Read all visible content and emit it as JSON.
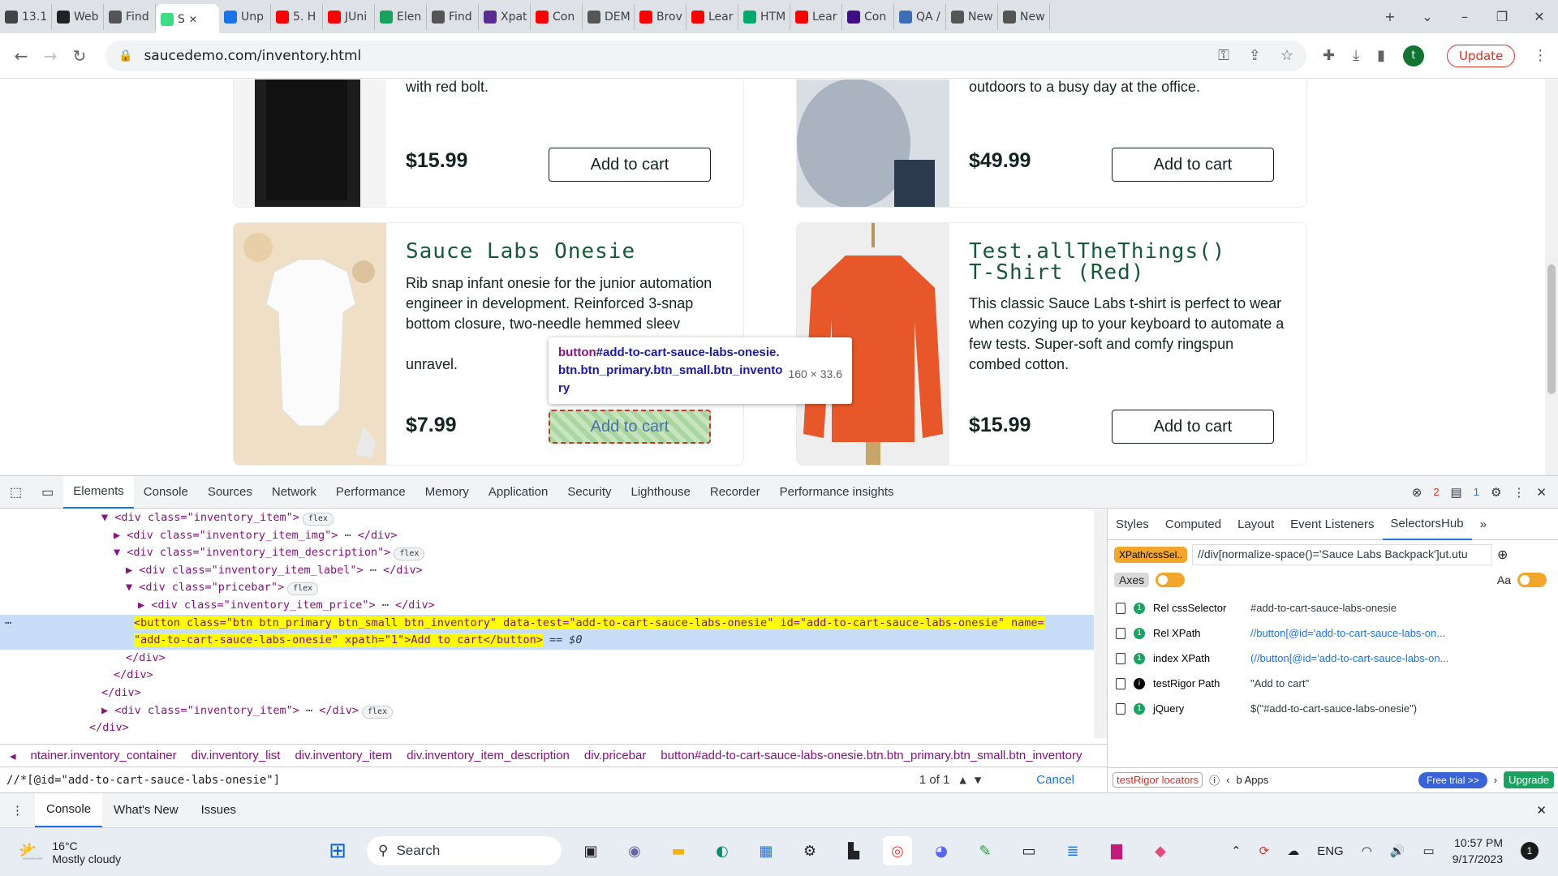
{
  "browser": {
    "tabs": [
      {
        "label": "13.1",
        "color": "#444"
      },
      {
        "label": "Web",
        "color": "#222"
      },
      {
        "label": "Find",
        "color": "#555"
      },
      {
        "label": "S",
        "color": "#3ddc84",
        "active": true
      },
      {
        "label": "Unp",
        "color": "#1a73e8"
      },
      {
        "label": "5. H",
        "color": "#ff0000"
      },
      {
        "label": "JUni",
        "color": "#ff0000"
      },
      {
        "label": "Elen",
        "color": "#1aa260"
      },
      {
        "label": "Find",
        "color": "#555"
      },
      {
        "label": "Xpat",
        "color": "#5c2d91"
      },
      {
        "label": "Con",
        "color": "#ff0000"
      },
      {
        "label": "DEM",
        "color": "#555"
      },
      {
        "label": "Brov",
        "color": "#ff0000"
      },
      {
        "label": "Lear",
        "color": "#ff0000"
      },
      {
        "label": "HTM",
        "color": "#04aa6d"
      },
      {
        "label": "Lear",
        "color": "#ff0000"
      },
      {
        "label": "Con",
        "color": "#3f0e84"
      },
      {
        "label": "QA /",
        "color": "#3b6fb6"
      },
      {
        "label": "New",
        "color": "#555"
      },
      {
        "label": "New",
        "color": "#555"
      }
    ],
    "url": "saucedemo.com/inventory.html",
    "update_label": "Update",
    "profile_initial": "t"
  },
  "products": [
    {
      "name": "",
      "desc": "with red bolt.",
      "price": "$15.99",
      "button": "Add to cart"
    },
    {
      "name": "",
      "desc": "outdoors to a busy day at the office.",
      "price": "$49.99",
      "button": "Add to cart"
    },
    {
      "name": "Sauce Labs Onesie",
      "desc": "Rib snap infant onesie for the junior automation engineer in development. Reinforced 3-snap bottom closure, two-needle hemmed sleev",
      "desc2": "unravel.",
      "price": "$7.99",
      "button": "Add to cart"
    },
    {
      "name": "Test.allTheThings() T-Shirt (Red)",
      "desc": "This classic Sauce Labs t-shirt is perfect to wear when cozying up to your keyboard to automate a few tests. Super-soft and comfy ringspun combed cotton.",
      "price": "$15.99",
      "button": "Add to cart"
    }
  ],
  "tooltip": {
    "selector_tag": "button",
    "selector_rest": "#add-to-cart-sauce-labs-onesie.btn.btn_primary.btn_small.btn_inventory",
    "size": "160 × 33.6"
  },
  "devtools": {
    "tabs": [
      "Elements",
      "Console",
      "Sources",
      "Network",
      "Performance",
      "Memory",
      "Application",
      "Security",
      "Lighthouse",
      "Recorder",
      "Performance insights"
    ],
    "error_count": "2",
    "message_count": "1",
    "dom_lines": [
      {
        "indent": 9,
        "arrow": "▼",
        "html": "<div class=\"inventory_item\">",
        "pill": "flex"
      },
      {
        "indent": 10,
        "arrow": "▶",
        "html": "<div class=\"inventory_item_img\">",
        "tail": "</div>"
      },
      {
        "indent": 10,
        "arrow": "▼",
        "html": "<div class=\"inventory_item_description\">",
        "pill": "flex"
      },
      {
        "indent": 11,
        "arrow": "▶",
        "html": "<div class=\"inventory_item_label\">",
        "tail": "</div>"
      },
      {
        "indent": 11,
        "arrow": "▼",
        "html": "<div class=\"pricebar\">",
        "pill": "flex"
      },
      {
        "indent": 12,
        "arrow": "▶",
        "html": "<div class=\"inventory_item_price\">",
        "tail": "</div>"
      }
    ],
    "selected_line_1": "<button class=\"btn btn_primary btn_small btn_inventory\" data-test=\"add-to-cart-sauce-labs-onesie\" id=\"add-to-cart-sauce-labs-onesie\" name=",
    "selected_line_2": "\"add-to-cart-sauce-labs-onesie\" xpath=\"1\">Add to cart</button>",
    "selected_suffix": "== $0",
    "closing_lines": [
      {
        "indent": 11,
        "text": "</div>"
      },
      {
        "indent": 10,
        "text": "</div>"
      },
      {
        "indent": 9,
        "text": "</div>"
      },
      {
        "indent": 9,
        "arrow": "▶",
        "text": "<div class=\"inventory_item\">",
        "tail": "</div>",
        "pill": "flex"
      },
      {
        "indent": 8,
        "text": "</div>"
      },
      {
        "indent": 7,
        "text": "</div>"
      }
    ],
    "breadcrumbs": [
      "ntainer.inventory_container",
      "div.inventory_list",
      "div.inventory_item",
      "div.inventory_item_description",
      "div.pricebar",
      "button#add-to-cart-sauce-labs-onesie.btn.btn_primary.btn_small.btn_inventory"
    ],
    "find_query": "//*[@id=\"add-to-cart-sauce-labs-onesie\"]",
    "find_count": "1 of 1",
    "cancel_label": "Cancel",
    "drawer_tabs": [
      "Console",
      "What's New",
      "Issues"
    ],
    "side_tabs": [
      "Styles",
      "Computed",
      "Layout",
      "Event Listeners",
      "SelectorsHub"
    ],
    "selectorshub": {
      "mode_button": "XPath/cssSel..",
      "input_value": "//div[normalize-space()='Sauce Labs Backpack']ut.utu",
      "axes_label": "Axes",
      "rows": [
        {
          "label": "Rel cssSelector",
          "value": "#add-to-cart-sauce-labs-onesie",
          "count": "1"
        },
        {
          "label": "Rel XPath",
          "value": "//button[@id='add-to-cart-sauce-labs-on...",
          "count": "1"
        },
        {
          "label": "index XPath",
          "value": "(//button[@id='add-to-cart-sauce-labs-on...",
          "count": "1"
        },
        {
          "label": "testRigor Path",
          "value": "\"Add to cart\"",
          "count": "i"
        },
        {
          "label": "jQuery",
          "value": "$(\"#add-to-cart-sauce-labs-onesie\")",
          "count": "1"
        }
      ],
      "testrigor_label": "testRigor locators",
      "apps_label": "b Apps",
      "free_trial": "Free trial >>",
      "upgrade": "Upgrade"
    }
  },
  "taskbar": {
    "temp": "16°C",
    "weather": "Mostly cloudy",
    "search": "Search",
    "lang": "ENG",
    "time": "10:57 PM",
    "date": "9/17/2023",
    "notifications": "1"
  }
}
